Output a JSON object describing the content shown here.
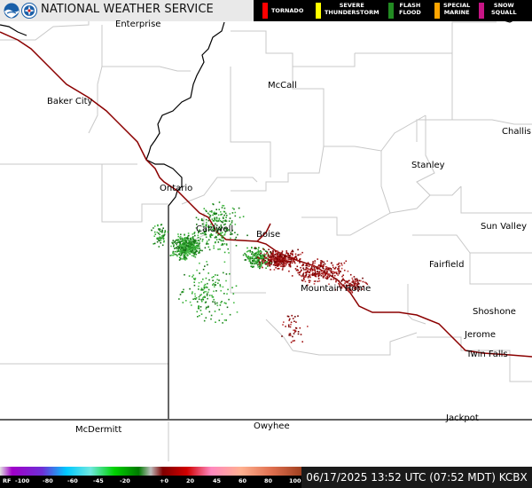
{
  "header": {
    "title": "NATIONAL WEATHER SERVICE",
    "legend": [
      {
        "label": "TORNADO",
        "color": "#ff0000"
      },
      {
        "label": "SEVERE\nTHUNDERSTORM",
        "color": "#ffff00"
      },
      {
        "label": "FLASH\nFLOOD",
        "color": "#228b22"
      },
      {
        "label": "SPECIAL\nMARINE",
        "color": "#ffa500"
      },
      {
        "label": "SNOW\nSQUALL",
        "color": "#c71585"
      }
    ]
  },
  "cities": [
    {
      "name": "Enterprise"
    },
    {
      "name": "McCall"
    },
    {
      "name": "Baker City"
    },
    {
      "name": "Challis"
    },
    {
      "name": "Stanley"
    },
    {
      "name": "Ontario"
    },
    {
      "name": "Caldwell"
    },
    {
      "name": "Boise"
    },
    {
      "name": "Sun Valley"
    },
    {
      "name": "Fairfield"
    },
    {
      "name": "Mountain Home"
    },
    {
      "name": "Shoshone"
    },
    {
      "name": "Jerome"
    },
    {
      "name": "Twin Falls"
    },
    {
      "name": "Jackpot"
    },
    {
      "name": "Owyhee"
    },
    {
      "name": "McDermitt"
    }
  ],
  "scale": {
    "prefix": "RF",
    "ticks": [
      "-100",
      "-80",
      "-60",
      "-45",
      "-20",
      "+0",
      "20",
      "45",
      "60",
      "80",
      "100"
    ]
  },
  "footer": {
    "timestamp": "06/17/2025 13:52 UTC (07:52 MDT) KCBX"
  },
  "colors": {
    "highway": "#8b0000",
    "county_lines": "#c8c8c8",
    "state_lines": "#000000",
    "inbound_velocity": "#1f8a1f",
    "outbound_velocity": "#8b0000"
  }
}
